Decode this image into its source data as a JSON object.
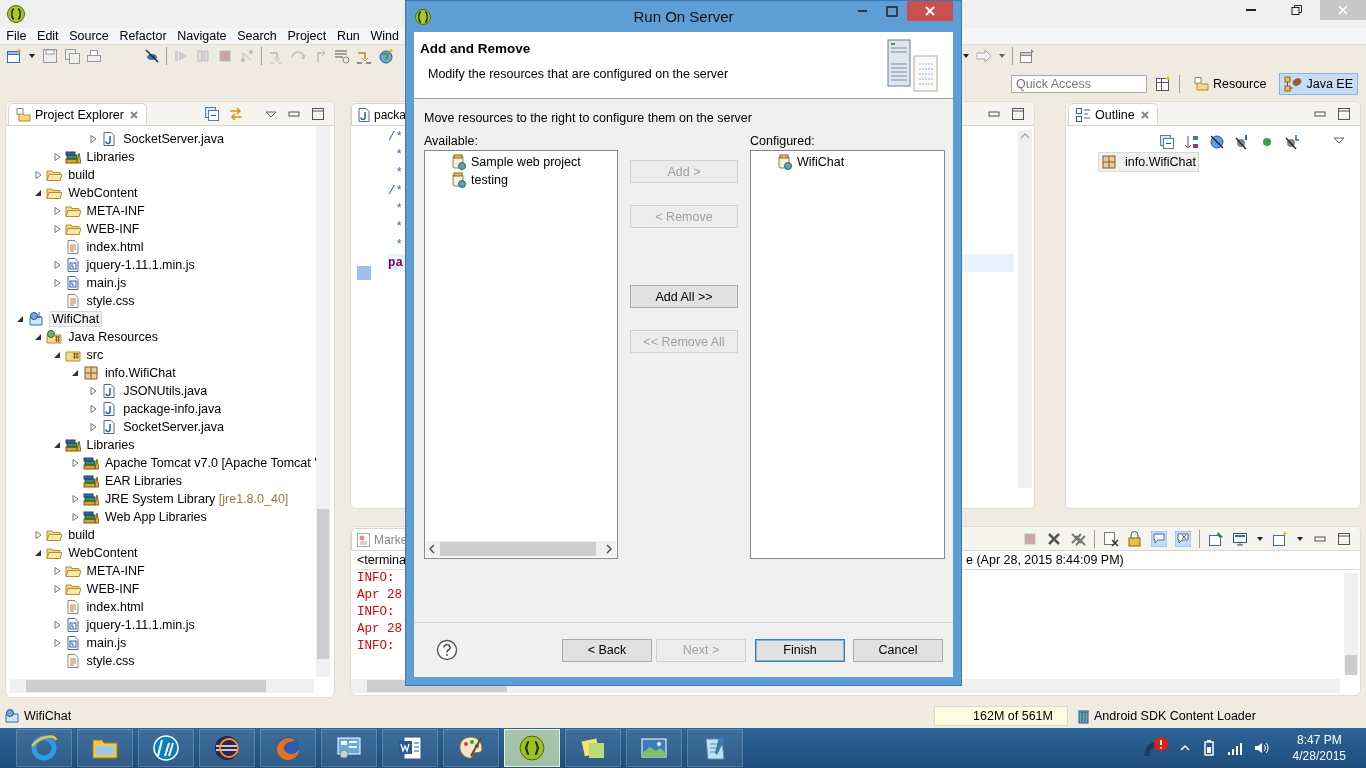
{
  "menu": [
    "File",
    "Edit",
    "Source",
    "Refactor",
    "Navigate",
    "Search",
    "Project",
    "Run",
    "Wind"
  ],
  "quick_access": {
    "placeholder": "Quick Access"
  },
  "perspectives": [
    {
      "label": "Resource",
      "selected": false
    },
    {
      "label": "Java EE",
      "selected": true
    }
  ],
  "explorer": {
    "title": "Project Explorer",
    "tree": [
      {
        "children": [
          {
            "children": [
              {
                "children": [
                  {
                    "children": [
                      {
                        "label": "SocketServer.java",
                        "kind": "java",
                        "expanded": false,
                        "selected": false
                      }
                    ]
                  }
                ]
              },
              {
                "label": "Libraries",
                "kind": "library",
                "expanded": false,
                "selected": false
              }
            ]
          },
          {
            "label": "build",
            "kind": "folder",
            "expanded": false,
            "selected": false
          },
          {
            "label": "WebContent",
            "kind": "folder",
            "expanded": true,
            "selected": false,
            "children": [
              {
                "label": "META-INF",
                "kind": "folder",
                "expanded": false,
                "selected": false
              },
              {
                "label": "WEB-INF",
                "kind": "folder",
                "expanded": false,
                "selected": false
              },
              {
                "label": "index.html",
                "kind": "text",
                "selected": false
              },
              {
                "label": "jquery-1.11.1.min.js",
                "kind": "script",
                "expanded": false,
                "selected": false
              },
              {
                "label": "main.js",
                "kind": "script",
                "expanded": false,
                "selected": false
              },
              {
                "label": "style.css",
                "kind": "text",
                "selected": false
              }
            ]
          }
        ]
      },
      {
        "label": "WifiChat",
        "kind": "project",
        "expanded": true,
        "selected": true,
        "children": [
          {
            "label": "Java Resources",
            "kind": "resources",
            "expanded": true,
            "selected": false,
            "children": [
              {
                "label": "src",
                "kind": "source",
                "expanded": true,
                "selected": false,
                "children": [
                  {
                    "label": "info.WifiChat",
                    "kind": "package",
                    "expanded": true,
                    "selected": false,
                    "children": [
                      {
                        "label": "JSONUtils.java",
                        "kind": "java",
                        "expanded": false,
                        "selected": false
                      },
                      {
                        "label": "package-info.java",
                        "kind": "java",
                        "expanded": false,
                        "selected": false
                      },
                      {
                        "label": "SocketServer.java",
                        "kind": "java",
                        "expanded": false,
                        "selected": false
                      }
                    ]
                  }
                ]
              },
              {
                "label": "Libraries",
                "kind": "library",
                "expanded": true,
                "selected": false,
                "children": [
                  {
                    "label": "Apache Tomcat v7.0 [Apache Tomcat '",
                    "kind": "library",
                    "expanded": false,
                    "selected": false
                  },
                  {
                    "label": "EAR Libraries",
                    "kind": "library",
                    "selected": false
                  },
                  {
                    "label": "JRE System Library",
                    "suffix": "[jre1.8.0_40]",
                    "kind": "library",
                    "expanded": false,
                    "selected": false
                  },
                  {
                    "label": "Web App Libraries",
                    "kind": "library",
                    "expanded": false,
                    "selected": false
                  }
                ]
              }
            ]
          },
          {
            "label": "build",
            "kind": "folder",
            "expanded": false,
            "selected": false
          },
          {
            "label": "WebContent",
            "kind": "folder",
            "expanded": true,
            "selected": false,
            "children": [
              {
                "label": "META-INF",
                "kind": "folder",
                "expanded": false,
                "selected": false
              },
              {
                "label": "WEB-INF",
                "kind": "folder",
                "expanded": false,
                "selected": false
              },
              {
                "label": "index.html",
                "kind": "text",
                "selected": false
              },
              {
                "label": "jquery-1.11.1.min.js",
                "kind": "script",
                "expanded": false,
                "selected": false
              },
              {
                "label": "main.js",
                "kind": "script",
                "expanded": false,
                "selected": false
              },
              {
                "label": "style.css",
                "kind": "text",
                "selected": false
              }
            ]
          }
        ]
      }
    ]
  },
  "editor": {
    "tab": "packa",
    "lines": [
      {
        "text": "/*",
        "kind": "comment"
      },
      {
        "text": " *",
        "kind": "comment"
      },
      {
        "text": " *",
        "kind": "comment"
      },
      {
        "text": "/*",
        "kind": "comment"
      },
      {
        "text": " *",
        "kind": "comment"
      },
      {
        "text": " *",
        "kind": "comment"
      },
      {
        "text": " *",
        "kind": "comment"
      },
      {
        "text": "pa",
        "kind": "keyword"
      }
    ]
  },
  "outline": {
    "title": "Outline",
    "items": [
      {
        "label": "info.WifiChat",
        "selected": true
      }
    ]
  },
  "console": {
    "tab": "Marke",
    "header": "<termina",
    "header_right": "e (Apr 28, 2015 8:44:09 PM)",
    "lines": [
      "INFO:",
      "Apr 28",
      "INFO:",
      "Apr 28",
      "INFO:"
    ]
  },
  "status_bar": {
    "selection": "WifiChat",
    "heap": "162M of 561M",
    "job": "Android SDK Content Loader"
  },
  "dialog": {
    "title": "Run On Server",
    "heading": "Add and Remove",
    "description": "Modify the resources that are configured on the server",
    "instruction": "Move resources to the right to configure them on the server",
    "available": {
      "label": "Available:",
      "items": [
        {
          "label": "Sample web project",
          "selected": false
        },
        {
          "label": "testing",
          "selected": false
        }
      ]
    },
    "configured": {
      "label": "Configured:",
      "items": [
        {
          "label": "WifiChat",
          "selected": false
        }
      ]
    },
    "move_buttons": [
      {
        "label": "Add >",
        "disabled": true
      },
      {
        "label": "< Remove",
        "disabled": true
      },
      {
        "label": "Add All >>",
        "disabled": false
      },
      {
        "label": "<< Remove All",
        "disabled": true
      }
    ],
    "buttons": [
      {
        "label": "< Back",
        "disabled": false,
        "default": false
      },
      {
        "label": "Next >",
        "disabled": true,
        "default": false
      },
      {
        "label": "Finish",
        "disabled": false,
        "default": true
      },
      {
        "label": "Cancel",
        "disabled": false,
        "default": false
      }
    ]
  },
  "taskbar": {
    "apps": [
      {
        "kind": "browser",
        "selected": false
      },
      {
        "kind": "files",
        "selected": false
      },
      {
        "kind": "round-logo",
        "selected": false
      },
      {
        "kind": "sphere",
        "selected": false
      },
      {
        "kind": "fox",
        "selected": false
      },
      {
        "kind": "panel",
        "selected": false
      },
      {
        "kind": "document",
        "selected": false
      },
      {
        "kind": "palette",
        "selected": false
      },
      {
        "kind": "bracket-logo",
        "selected": true
      },
      {
        "kind": "notes",
        "selected": false
      },
      {
        "kind": "picture",
        "selected": false
      },
      {
        "kind": "notepad",
        "selected": false
      }
    ],
    "time": "8:47 PM",
    "date": "4/28/2015"
  }
}
